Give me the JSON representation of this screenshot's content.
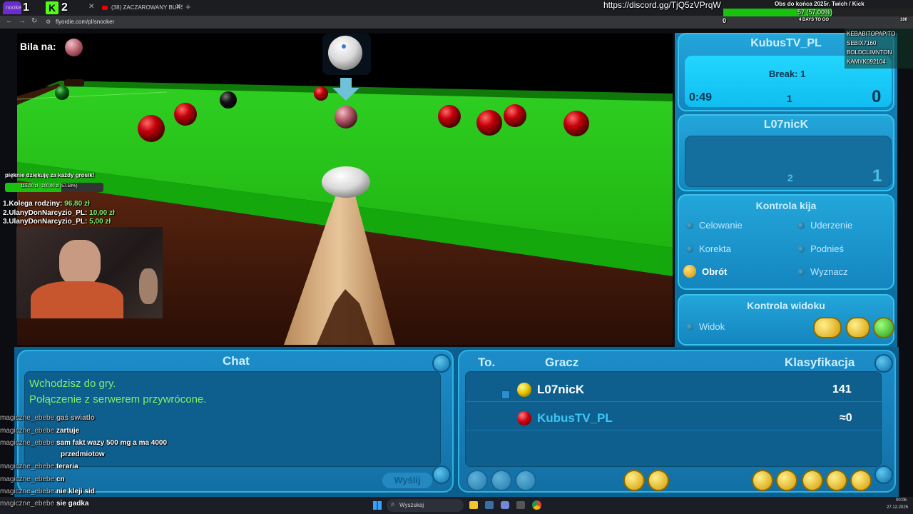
{
  "browser": {
    "tabs": [
      {
        "label": "nooker"
      },
      {
        "label": "(38) ZACZAROWANY BURŚ"
      }
    ],
    "url": "flyordie.com/pl/snooker"
  },
  "stream_overlay": {
    "kick_count": "1",
    "kick_count_2": "2",
    "discord_link": "https://discord.gg/TjQ5zVPrqW",
    "goal_title": "Obs do końca 2025r. Twich / Kick",
    "goal_progress_text": "57 (57.00%)",
    "goal_progress": 0.57,
    "goal_left": "0",
    "goal_right": "100",
    "days_to_go": "4 DAYS TO GO",
    "viewers": [
      "KEBABITOPAPITO",
      "SEBIX7160",
      "BOLDCLIMNTON",
      "KAMYK092104"
    ],
    "donation_thanks": "pięknie dziękuję za każdy grosik!",
    "donation_progress_text": "115,00 zł - 200,00 zł (57.50%)",
    "donation_progress": 0.575,
    "donors": [
      {
        "name": "1.Kolega rodziny:",
        "amount": "96,80 zł"
      },
      {
        "name": "2.UlanyDonNarcyzio_PL:",
        "amount": "10,00 zł"
      },
      {
        "name": "3.UlanyDonNarcyzio_PL:",
        "amount": "5,00 zł"
      }
    ]
  },
  "game": {
    "ball_on_label": "Bila na:",
    "player1": {
      "name": "KubusTV_PL",
      "break_label": "Break: 1",
      "timer": "0:49",
      "frames": "1",
      "score": "0"
    },
    "player2": {
      "name": "L07nicK",
      "frames": "2",
      "score": "1"
    },
    "cue_control": {
      "title": "Kontrola kija",
      "items": [
        "Celowanie",
        "Uderzenie",
        "Korekta",
        "Podnieś",
        "Obrót",
        "Wyznacz"
      ],
      "active": "Obrót"
    },
    "view_control": {
      "title": "Kontrola widoku",
      "view_label": "Widok"
    },
    "chat": {
      "title": "Chat",
      "messages": [
        "Wchodzisz do gry.",
        "Połączenie z serwerem przywrócone."
      ],
      "send_label": "Wyślij"
    },
    "ranking": {
      "col_to": "To.",
      "col_player": "Gracz",
      "col_rank": "Klasyfikacja",
      "rows": [
        {
          "name": "L07nicK",
          "rank": "141",
          "ball": "#e8c800"
        },
        {
          "name": "KubusTV_PL",
          "rank": "≈0",
          "ball": "#d00010"
        }
      ]
    }
  },
  "stream_chat": [
    {
      "user": "magiczne_ebebe",
      "msg": "gaś swiatlo"
    },
    {
      "user": "magiczne_ebebe",
      "msg": "zartuje"
    },
    {
      "user": "magiczne_ebebe",
      "msg": "sam fakt wazy 500 mg a ma 4000"
    },
    {
      "user": "",
      "msg": "przedmiotow"
    },
    {
      "user": "magiczne_ebebe",
      "msg": "teraria"
    },
    {
      "user": "magiczne_ebebe",
      "msg": "cn"
    },
    {
      "user": "magiczne_ebebe",
      "msg": "nie kleji sid"
    },
    {
      "user": "magiczne_ebebe",
      "msg": "sie gadka"
    }
  ],
  "taskbar": {
    "search_placeholder": "Wyszukaj",
    "time": "00:06",
    "date": "27.12.2025"
  }
}
